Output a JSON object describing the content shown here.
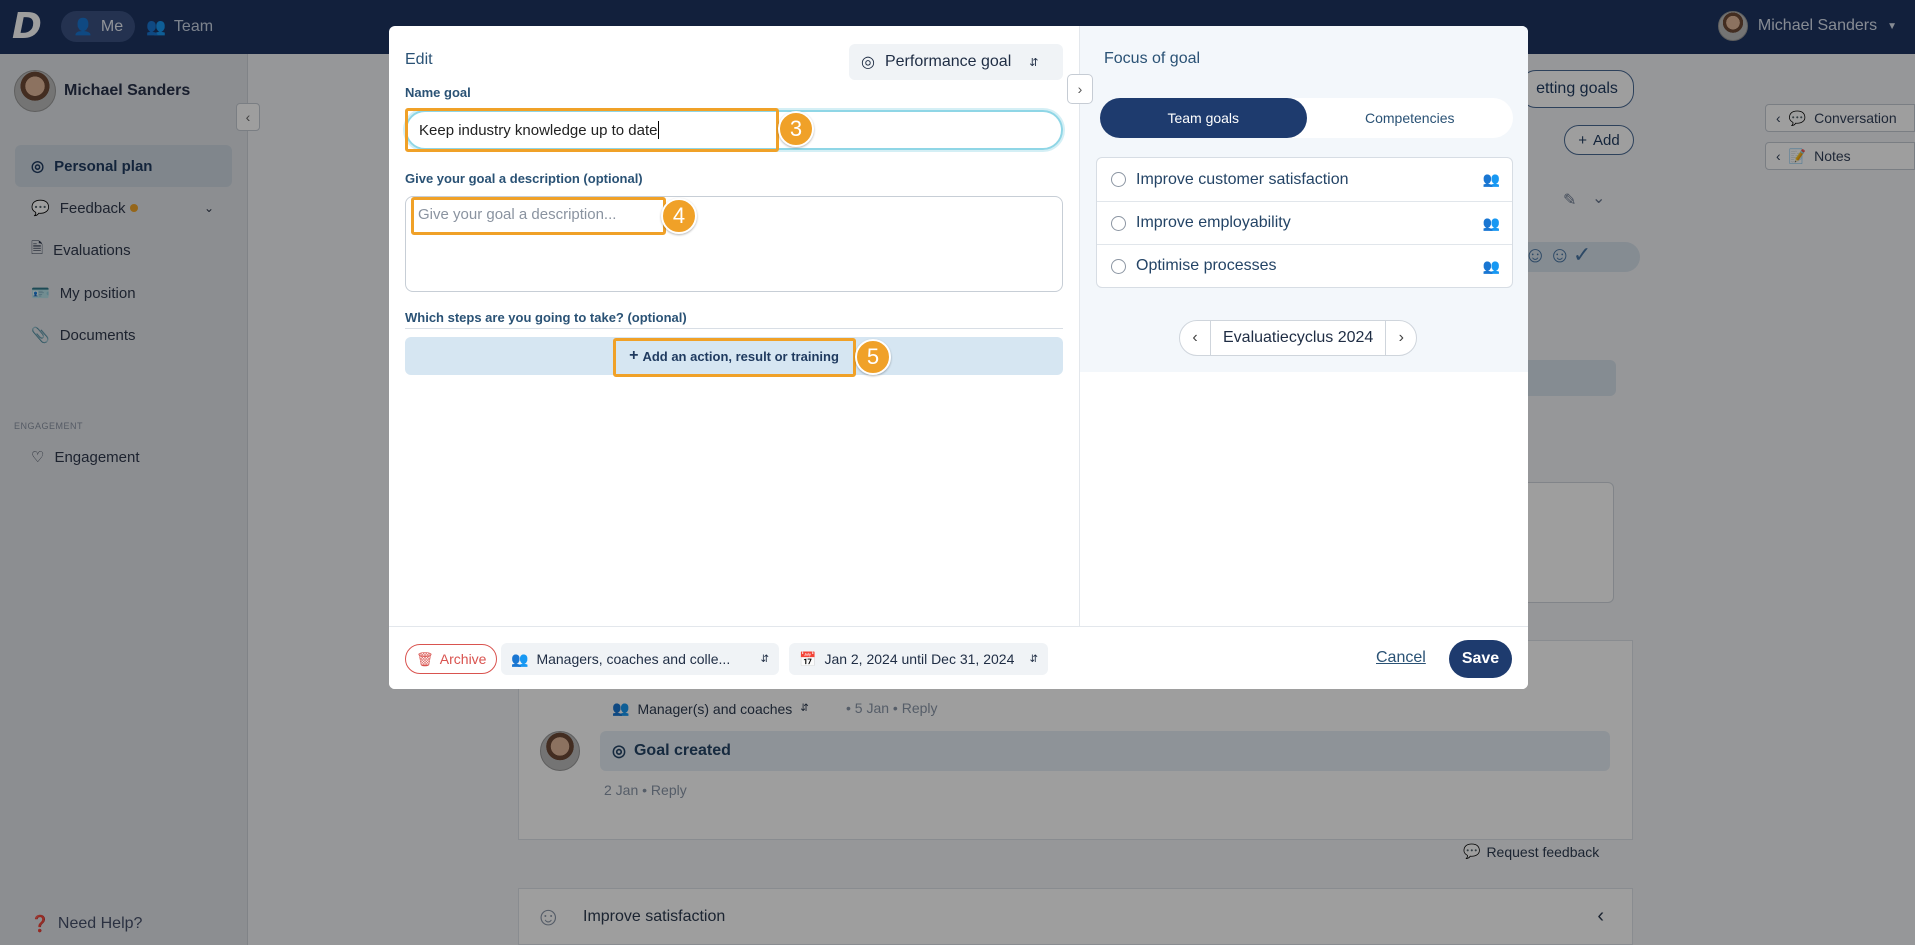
{
  "topbar": {
    "me_label": "Me",
    "team_label": "Team",
    "user_name": "Michael Sanders"
  },
  "sidebar": {
    "user_name": "Michael Sanders",
    "items": [
      {
        "label": "Personal plan",
        "icon": "target-icon"
      },
      {
        "label": "Feedback",
        "icon": "chat-icon"
      },
      {
        "label": "Evaluations",
        "icon": "document-icon"
      },
      {
        "label": "My position",
        "icon": "id-card-icon"
      },
      {
        "label": "Documents",
        "icon": "paperclip-icon"
      },
      {
        "label": "Engagement",
        "icon": "heart-icon"
      }
    ],
    "section_engagement": "ENGAGEMENT",
    "help": "Need Help?"
  },
  "background": {
    "setting_goals": "etting goals",
    "add": "Add",
    "conversation": "Conversation",
    "notes": "Notes",
    "visibility": "Manager(s) and coaches",
    "meta1": "• 5 Jan   • Reply",
    "goal_created": "Goal created",
    "meta2": "2 Jan   • Reply",
    "request_feedback": "Request feedback",
    "improve_satisfaction": "Improve satisfaction"
  },
  "modal": {
    "edit_title": "Edit",
    "goal_type": "Performance goal",
    "name_label": "Name goal",
    "name_value": "Keep industry knowledge up to date",
    "desc_label": "Give your goal a description (optional)",
    "desc_placeholder": "Give your goal a description...",
    "steps_label": "Which steps are you going to take? (optional)",
    "add_action": "Add an action, result or training",
    "focus_title": "Focus of goal",
    "tabs": [
      "Team goals",
      "Competencies"
    ],
    "team_goals": [
      "Improve customer satisfaction",
      "Improve employability",
      "Optimise processes"
    ],
    "cycle": "Evaluatiecyclus 2024",
    "footer": {
      "archive": "Archive",
      "visibility": "Managers, coaches and colle...",
      "period": "Jan 2, 2024 until Dec 31, 2024",
      "cancel": "Cancel",
      "save": "Save"
    }
  },
  "steps": [
    "3",
    "4",
    "5"
  ],
  "colors": {
    "navy": "#1d3461",
    "accent": "#f0a128",
    "save": "#1e3b6e",
    "archive": "#d9534f"
  }
}
